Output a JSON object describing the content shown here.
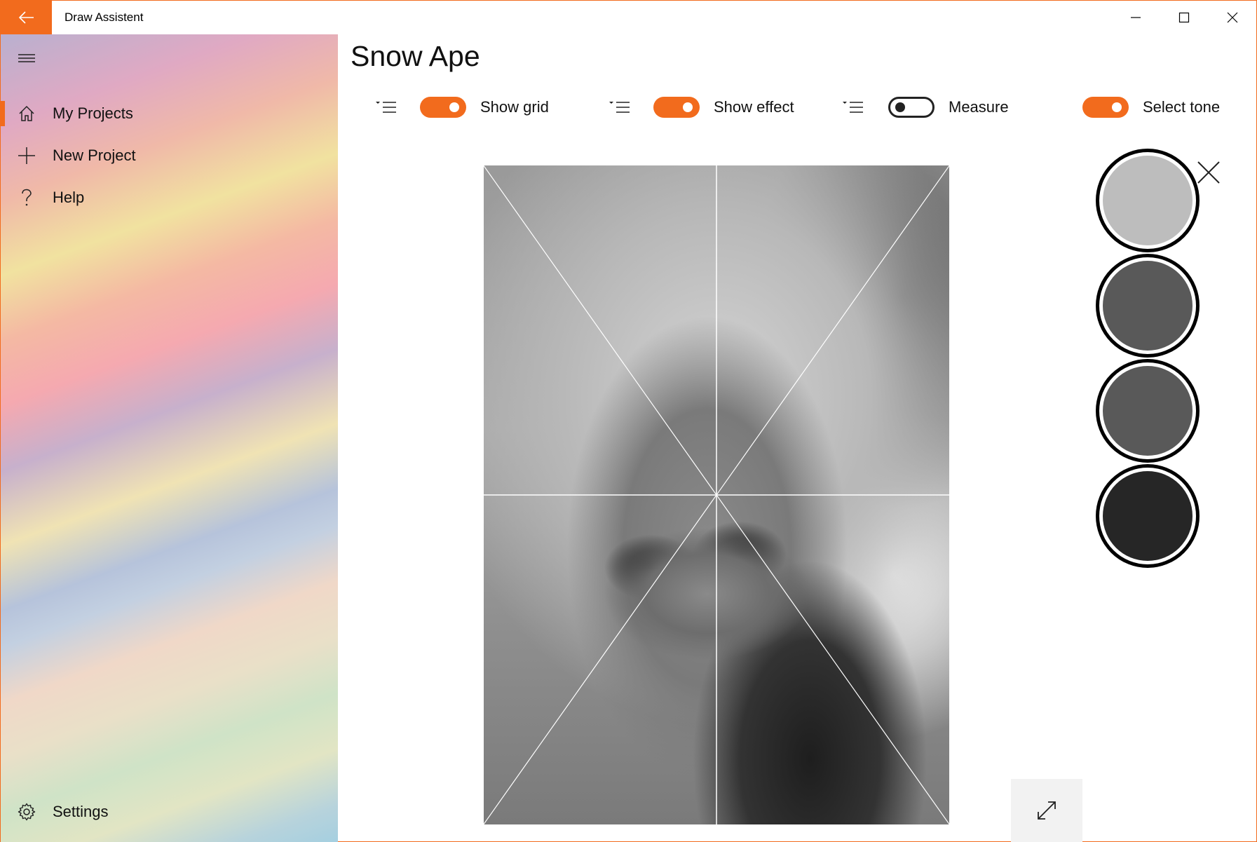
{
  "app": {
    "title": "Draw Assistent"
  },
  "colors": {
    "accent": "#f26b1d"
  },
  "sidebar": {
    "items": [
      {
        "label": "My Projects",
        "icon": "home-icon",
        "active": true
      },
      {
        "label": "New Project",
        "icon": "plus-icon",
        "active": false
      },
      {
        "label": "Help",
        "icon": "question-icon",
        "active": false
      }
    ],
    "footer": {
      "label": "Settings",
      "icon": "gear-icon"
    }
  },
  "main": {
    "title": "Snow Ape",
    "toggles": [
      {
        "label": "Show grid",
        "on": true
      },
      {
        "label": "Show effect",
        "on": true
      },
      {
        "label": "Measure",
        "on": false
      },
      {
        "label": "Select tone",
        "on": true
      }
    ]
  },
  "tones": [
    {
      "color": "#bdbdbd"
    },
    {
      "color": "#595959"
    },
    {
      "color": "#595959"
    },
    {
      "color": "#262626"
    }
  ]
}
